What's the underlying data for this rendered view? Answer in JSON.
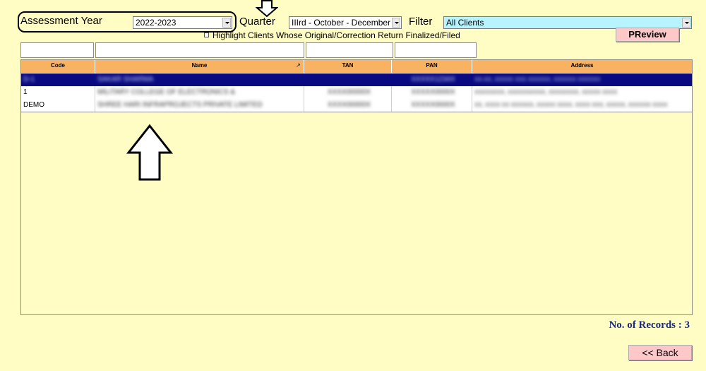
{
  "header": {
    "assessment_year_label": "Assessment Year",
    "assessment_year_value": "2022-2023",
    "quarter_label": "Quarter",
    "quarter_value": "IIIrd - October - December",
    "filter_label": "Filter",
    "filter_value": "All Clients",
    "highlight_label": "Highlight Clients Whose Original/Correction Return Finalized/Filed",
    "preview_label": "PReview"
  },
  "table": {
    "columns": [
      "Code",
      "Name",
      "TAN",
      "PAN",
      "Address"
    ],
    "rows": [
      [
        "D-1",
        "SAKAR SHARMA",
        "",
        "XXXXX1234X",
        "XX-XX, XXXXX XXX XXXXXX, XXXXXX XXXXXX"
      ],
      [
        "1",
        "MILITARY COLLEGE OF ELECTRONICS &",
        "XXXX00000X",
        "XXXXX0000X",
        "XXXXXXXX, XXXXXXXXXX, XXXXXXXX, XXXXX XXXX"
      ],
      [
        "DEMO",
        "SHREE HARI INFRAPROJECTS PRIVATE LIMITED",
        "XXXX00000X",
        "XXXXX0000X",
        "XX, XXXX XX XXXXXX, XXXXX XXXX, XXXX XXX, XXXXX, XXXXXX XXXX"
      ]
    ]
  },
  "footer": {
    "records_label": "No. of Records : 3",
    "back_label": "<< Back"
  },
  "colors": {
    "background": "#fffdc4",
    "header_orange": "#f9b162",
    "selected_row": "#0a0a80",
    "filter_bg": "#b8f4ff",
    "button_pink": "#ffc8c8",
    "records_text": "#1a2a8a"
  }
}
